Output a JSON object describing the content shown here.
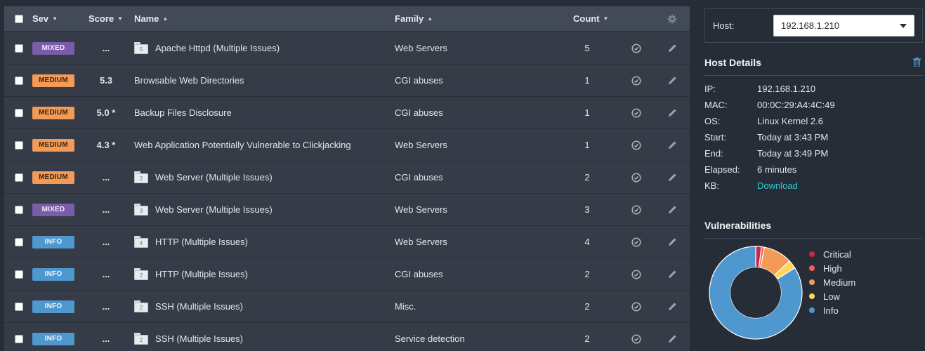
{
  "table": {
    "headers": {
      "sev": "Sev",
      "score": "Score",
      "name": "Name",
      "family": "Family",
      "count": "Count"
    },
    "rows": [
      {
        "sev": "MIXED",
        "sev_type": "mixed",
        "score": "...",
        "folder_count": "5",
        "name": "Apache Httpd (Multiple Issues)",
        "family": "Web Servers",
        "count": "5"
      },
      {
        "sev": "MEDIUM",
        "sev_type": "medium",
        "score": "5.3",
        "folder_count": "",
        "name": "Browsable Web Directories",
        "family": "CGI abuses",
        "count": "1"
      },
      {
        "sev": "MEDIUM",
        "sev_type": "medium",
        "score": "5.0 *",
        "folder_count": "",
        "name": "Backup Files Disclosure",
        "family": "CGI abuses",
        "count": "1"
      },
      {
        "sev": "MEDIUM",
        "sev_type": "medium",
        "score": "4.3 *",
        "folder_count": "",
        "name": "Web Application Potentially Vulnerable to Clickjacking",
        "family": "Web Servers",
        "count": "1"
      },
      {
        "sev": "MEDIUM",
        "sev_type": "medium",
        "score": "...",
        "folder_count": "2",
        "name": "Web Server (Multiple Issues)",
        "family": "CGI abuses",
        "count": "2"
      },
      {
        "sev": "MIXED",
        "sev_type": "mixed",
        "score": "...",
        "folder_count": "3",
        "name": "Web Server (Multiple Issues)",
        "family": "Web Servers",
        "count": "3"
      },
      {
        "sev": "INFO",
        "sev_type": "info",
        "score": "...",
        "folder_count": "4",
        "name": "HTTP (Multiple Issues)",
        "family": "Web Servers",
        "count": "4"
      },
      {
        "sev": "INFO",
        "sev_type": "info",
        "score": "...",
        "folder_count": "2",
        "name": "HTTP (Multiple Issues)",
        "family": "CGI abuses",
        "count": "2"
      },
      {
        "sev": "INFO",
        "sev_type": "info",
        "score": "...",
        "folder_count": "2",
        "name": "SSH (Multiple Issues)",
        "family": "Misc.",
        "count": "2"
      },
      {
        "sev": "INFO",
        "sev_type": "info",
        "score": "...",
        "folder_count": "2",
        "name": "SSH (Multiple Issues)",
        "family": "Service detection",
        "count": "2"
      }
    ]
  },
  "host": {
    "label": "Host:",
    "selected": "192.168.1.210"
  },
  "host_details": {
    "title": "Host Details",
    "items": [
      {
        "key": "IP:",
        "value": "192.168.1.210"
      },
      {
        "key": "MAC:",
        "value": "00:0C:29:A4:4C:49"
      },
      {
        "key": "OS:",
        "value": "Linux Kernel 2.6"
      },
      {
        "key": "Start:",
        "value": "Today at 3:43 PM"
      },
      {
        "key": "End:",
        "value": "Today at 3:49 PM"
      },
      {
        "key": "Elapsed:",
        "value": "6 minutes"
      },
      {
        "key": "KB:",
        "value": "Download"
      }
    ]
  },
  "vulnerabilities": {
    "title": "Vulnerabilities",
    "legend": [
      {
        "label": "Critical",
        "color": "#c7254e"
      },
      {
        "label": "High",
        "color": "#ee5f5b"
      },
      {
        "label": "Medium",
        "color": "#f29a56"
      },
      {
        "label": "Low",
        "color": "#fcd75c"
      },
      {
        "label": "Info",
        "color": "#4f97cf"
      }
    ]
  },
  "chart_data": {
    "type": "pie",
    "categories": [
      "Critical",
      "High",
      "Medium",
      "Low",
      "Info"
    ],
    "values": [
      2,
      1,
      10,
      3,
      84
    ],
    "colors": [
      "#c7254e",
      "#ee5f5b",
      "#f29a56",
      "#fcd75c",
      "#4f97cf"
    ],
    "donut": true,
    "legend": "right"
  },
  "colors": {
    "mixed": "#7a5ca8",
    "medium": "#f29a56",
    "info": "#4f97cf",
    "link": "#2fc7d0"
  }
}
